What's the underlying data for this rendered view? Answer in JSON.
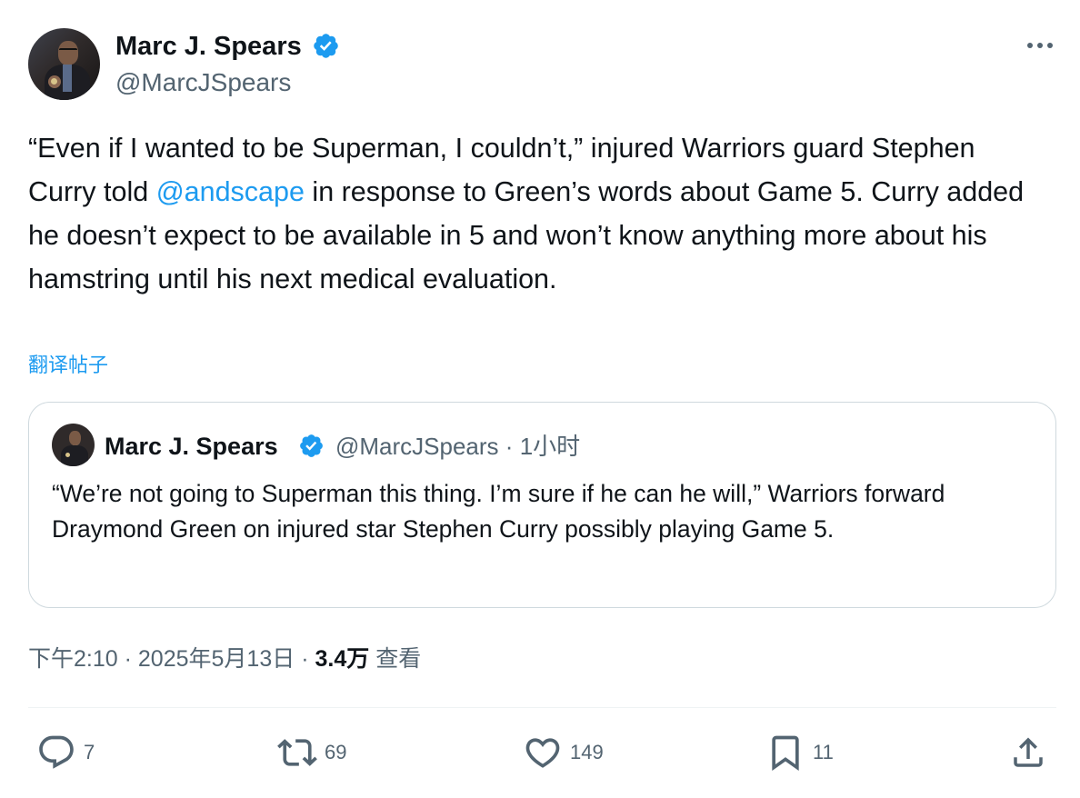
{
  "author": {
    "name": "Marc J. Spears",
    "handle": "@MarcJSpears",
    "verified": true
  },
  "post": {
    "text_before_mention": "“Even if I wanted to be Superman, I couldn’t,” injured Warriors guard Stephen Curry told ",
    "mention": "@andscape",
    "text_after_mention": " in response to Green’s words about Game 5. Curry added he doesn’t expect to be available in 5 and won’t know anything more about his hamstring until his next medical evaluation.",
    "translate_label": "翻译帖子"
  },
  "quoted": {
    "name": "Marc J. Spears",
    "handle": "@MarcJSpears",
    "separator": "·",
    "time": "1小时",
    "text": "“We’re not going to Superman this thing. I’m sure if he can he will,” Warriors forward Draymond Green on injured star Stephen Curry possibly playing Game 5."
  },
  "meta": {
    "time": "下午2:10",
    "separator": "·",
    "date": "2025年5月13日",
    "views_count": "3.4万",
    "views_label": "查看"
  },
  "actions": {
    "replies": "7",
    "reposts": "69",
    "likes": "149",
    "bookmarks": "11"
  },
  "colors": {
    "accent": "#1d9bf0",
    "secondary_text": "#536471",
    "primary_text": "#0f1419",
    "border": "#cfd9de"
  },
  "icons": [
    "more-icon",
    "verified-badge-icon",
    "reply-icon",
    "repost-icon",
    "like-icon",
    "bookmark-icon",
    "share-icon"
  ]
}
